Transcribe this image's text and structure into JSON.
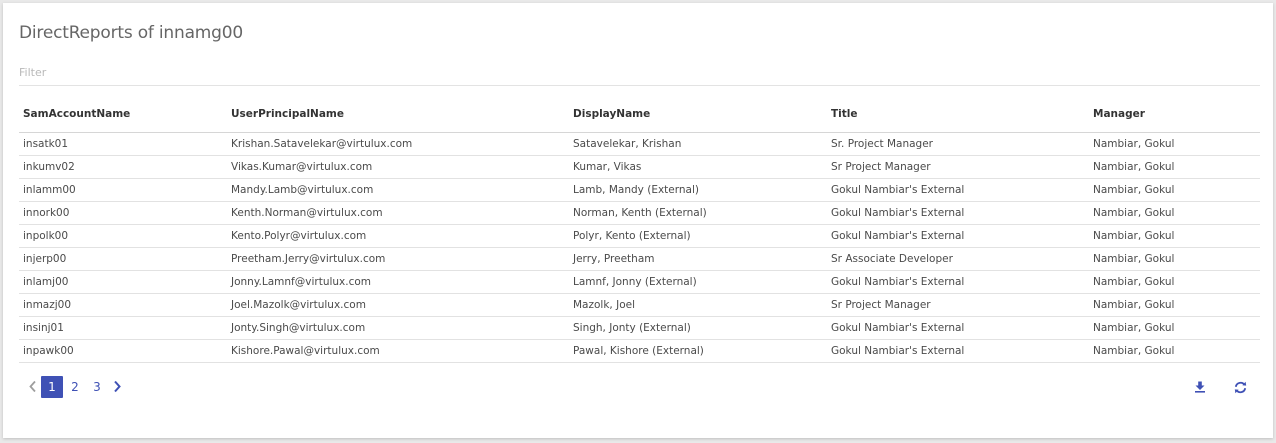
{
  "panel": {
    "title": "DirectReports of innamg00",
    "filter_placeholder": "Filter"
  },
  "table": {
    "columns": [
      "SamAccountName",
      "UserPrincipalName",
      "DisplayName",
      "Title",
      "Manager"
    ],
    "rows": [
      [
        "insatk01",
        "Krishan.Satavelekar@virtulux.com",
        "Satavelekar, Krishan",
        "Sr. Project Manager",
        "Nambiar, Gokul"
      ],
      [
        "inkumv02",
        "Vikas.Kumar@virtulux.com",
        "Kumar, Vikas",
        "Sr Project Manager",
        "Nambiar, Gokul"
      ],
      [
        "inlamm00",
        "Mandy.Lamb@virtulux.com",
        "Lamb, Mandy (External)",
        "Gokul Nambiar's External",
        "Nambiar, Gokul"
      ],
      [
        "innork00",
        "Kenth.Norman@virtulux.com",
        "Norman, Kenth (External)",
        "Gokul Nambiar's External",
        "Nambiar, Gokul"
      ],
      [
        "inpolk00",
        "Kento.Polyr@virtulux.com",
        "Polyr, Kento (External)",
        "Gokul Nambiar's External",
        "Nambiar, Gokul"
      ],
      [
        "injerp00",
        "Preetham.Jerry@virtulux.com",
        "Jerry, Preetham",
        "Sr Associate Developer",
        "Nambiar, Gokul"
      ],
      [
        "inlamj00",
        "Jonny.Lamnf@virtulux.com",
        "Lamnf, Jonny (External)",
        "Gokul Nambiar's External",
        "Nambiar, Gokul"
      ],
      [
        "inmazj00",
        "Joel.Mazolk@virtulux.com",
        "Mazolk, Joel",
        "Sr Project Manager",
        "Nambiar, Gokul"
      ],
      [
        "insinj01",
        "Jonty.Singh@virtulux.com",
        "Singh, Jonty (External)",
        "Gokul Nambiar's External",
        "Nambiar, Gokul"
      ],
      [
        "inpawk00",
        "Kishore.Pawal@virtulux.com",
        "Pawal, Kishore (External)",
        "Gokul Nambiar's External",
        "Nambiar, Gokul"
      ]
    ]
  },
  "pagination": {
    "pages": [
      "1",
      "2",
      "3"
    ],
    "current": "1",
    "prev_icon": "chevron-left-icon",
    "next_icon": "chevron-right-icon"
  },
  "actions": {
    "download_icon": "download-icon",
    "refresh_icon": "refresh-icon"
  },
  "colors": {
    "accent": "#3f51b5",
    "arrow_disabled": "#9e9e9e",
    "text": "#4a4a4a"
  }
}
